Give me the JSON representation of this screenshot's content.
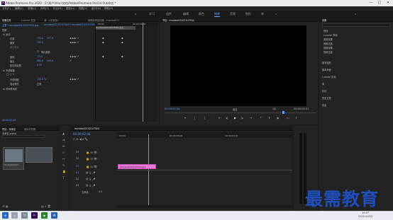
{
  "window": {
    "title": "Adobe Premiere Pro 2020 - C:\\用户\\Ahui\\文档\\Adobe\\Premiere Pro\\14.0\\未命名 *",
    "logo_text": "Pr",
    "minimize": "—",
    "maximize": "□",
    "close": "✕"
  },
  "menu": [
    "文件(F)",
    "编辑(E)",
    "剪辑(C)",
    "序列(S)",
    "标记(M)",
    "图形(G)",
    "视图(V)",
    "窗口(W)",
    "帮助(H)"
  ],
  "workspaces": [
    "学习",
    "组件",
    "编辑",
    "颜色",
    "效果",
    "音频",
    "图形",
    "库"
  ],
  "workspace_active": "效果",
  "effect_controls": {
    "tabs": [
      "效果控件",
      "Lumetri 范围",
      "源：<无剪辑>",
      "音频剪辑混合器：Imvideo021"
    ],
    "source_line": "主要 * Imvideo02102107504.jpg",
    "sequence_line": "Imvideo02102107504 * Imvideo02102107504.jpg",
    "section": "视频",
    "motion": "fx 运动",
    "position_label": "位置",
    "position_x": "702.0",
    "position_y": "337.5",
    "scale_label": "缩放",
    "scale_value": "100.0",
    "scale_width_label": "缩放宽度",
    "uniform_scale_label": "等比缩放",
    "rotation_label": "旋转",
    "rotation_value": "-15.0",
    "anchor_label": "锚点",
    "anchor_x": "960.0",
    "anchor_y": "540.0",
    "flicker_label": "防闪烁滤镜",
    "flicker_value": "0.00",
    "opacity": "fx 不透明度",
    "opacity_label": "不透明度",
    "opacity_value": "100.0 %",
    "blend_label": "混合模式",
    "blend_value": "正常",
    "time_remap": "fx 时间重映射",
    "timecode": "00:00:02:06",
    "ruler_start": ":00:00",
    "ruler_end": "00:00:05:00",
    "clip_name": "Imvideo02102107504.jpg"
  },
  "program_monitor": {
    "tab": "节目：Imvideo02102107504",
    "timecode_left": "00:00:02:06",
    "fit": "适合",
    "fraction": "1/2",
    "timecode_right": "00:00:05:01"
  },
  "project": {
    "tabs": [
      "项目：未命名",
      "媒体浏览器"
    ],
    "name": "未命名.prproj",
    "thumb_label": "Imvideo021021..."
  },
  "timeline": {
    "tab": "Imvideo02102107504",
    "timecode": "00:00:02:06",
    "ruler": [
      ":00:00",
      "00:00:05:00",
      "00:00:10:00"
    ],
    "tracks": [
      "V3",
      "V2",
      "V1",
      "A1",
      "A2",
      "A3"
    ],
    "master": "主声道",
    "master_value": "0.0",
    "clip_label": "Imvideo02102107504.jpg"
  },
  "right_panel": {
    "tabs": [
      "效果"
    ],
    "items": [
      "预设",
      "Lumetri 预设",
      "音频效果",
      "音频过渡",
      "视频效果",
      "视频过渡"
    ],
    "sections": [
      "基本图形",
      "基本声音",
      "Lumetri 颜色",
      "库",
      "标记",
      "历史记录",
      "信息"
    ]
  },
  "taskbar": {
    "time": "10:07",
    "date": "2021/10/22"
  },
  "watermark": "最需教育",
  "colors": {
    "accent_blue": "#5b9bff",
    "clip_pink": "#e878d8",
    "watermark_blue": "#1f4fbf"
  }
}
